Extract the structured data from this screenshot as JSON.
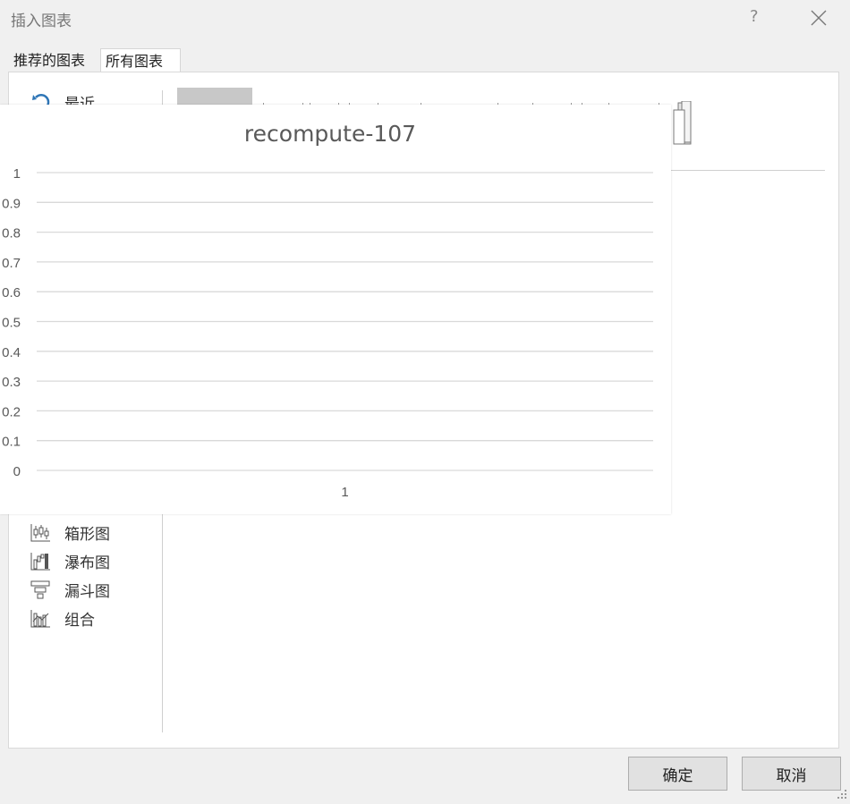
{
  "window": {
    "title": "插入图表",
    "help": "?"
  },
  "tabs": [
    {
      "label": "推荐的图表",
      "active": false
    },
    {
      "label": "所有图表",
      "active": true
    }
  ],
  "categories": [
    {
      "label": "最近",
      "icon": "recent-icon"
    },
    {
      "label": "箱形图",
      "icon": "box-whisker-icon"
    },
    {
      "label": "瀑布图",
      "icon": "waterfall-icon"
    },
    {
      "label": "漏斗图",
      "icon": "funnel-icon"
    },
    {
      "label": "组合",
      "icon": "combo-chart-icon"
    }
  ],
  "chart_data": {
    "type": "bar",
    "title": "recompute-107",
    "categories": [
      "1"
    ],
    "series": [],
    "yticks": [
      "0",
      "0.1",
      "0.2",
      "0.3",
      "0.4",
      "0.5",
      "0.6",
      "0.7",
      "0.8",
      "0.9",
      "1"
    ],
    "ylim": [
      0,
      1
    ],
    "grid": true,
    "gridColor": "#d9d9d9",
    "textColor": "#595959"
  },
  "buttons": {
    "ok": "确定",
    "cancel": "取消"
  },
  "colors": {
    "accent": "#2e75b6",
    "icon": "#555555"
  }
}
